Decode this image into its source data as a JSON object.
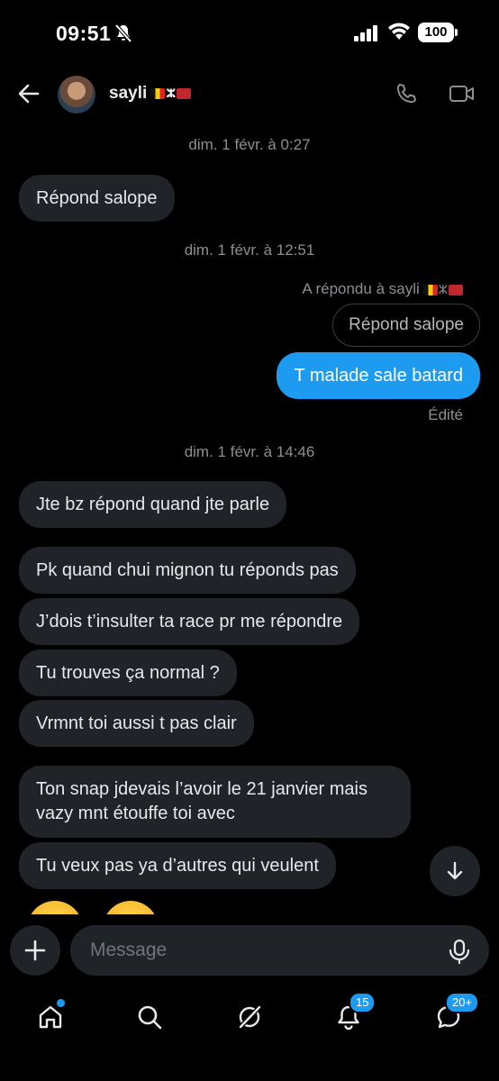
{
  "status_bar": {
    "time": "09:51",
    "battery": "100"
  },
  "header": {
    "contact_name": "sayli"
  },
  "chat": {
    "ts1": "dim. 1 févr. à 0:27",
    "msg1": "Répond salope",
    "ts2": "dim. 1 févr. à 12:51",
    "reply_label": "A répondu à sayli",
    "quoted": "Répond salope",
    "sent1": "T malade sale batard",
    "edited": "Édité",
    "ts3": "dim. 1 févr. à 14:46",
    "msg2": "Jte bz répond quand jte parle",
    "msg3": "Pk quand chui mignon tu réponds pas",
    "msg4": "J’dois t’insulter ta race pr me répondre",
    "msg5": "Tu trouves ça normal ?",
    "msg6": "Vrmnt toi aussi t pas clair",
    "msg7": "Ton snap jdevais l’avoir le 21 janvier mais vazy mnt étouffe toi avec",
    "msg8": "Tu veux pas ya d’autres qui veulent"
  },
  "composer": {
    "placeholder": "Message"
  },
  "nav": {
    "notifications_badge": "15",
    "messages_badge": "20+"
  },
  "colors": {
    "accent": "#1d9bf0",
    "bubble": "#202327",
    "background": "#000000"
  }
}
